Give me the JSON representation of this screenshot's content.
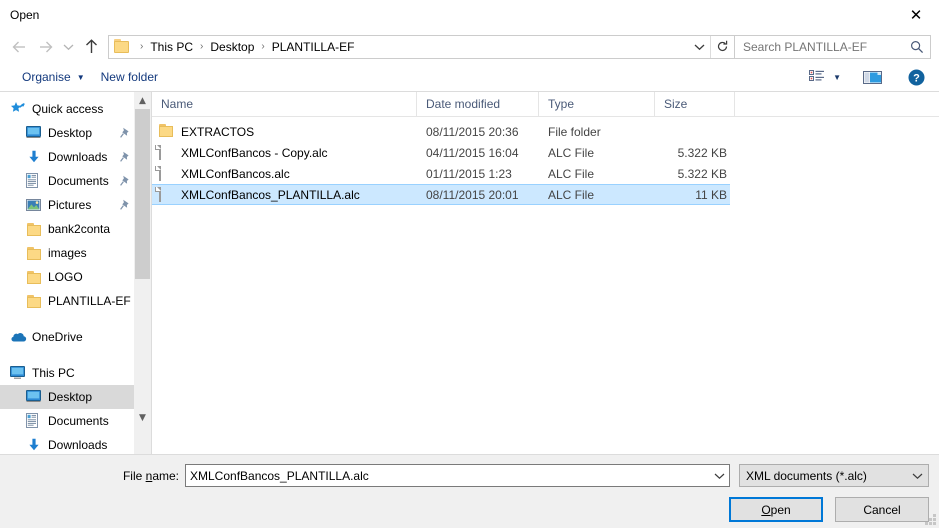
{
  "window": {
    "title": "Open",
    "close_icon": "close-icon"
  },
  "nav": {
    "back_icon": "arrow-left-icon",
    "forward_icon": "arrow-right-icon",
    "recent_icon": "chevron-down-icon",
    "up_icon": "arrow-up-icon",
    "breadcrumb": [
      "This PC",
      "Desktop",
      "PLANTILLA-EF"
    ],
    "breadcrumb_separator": "›",
    "dropdown_icon": "chevron-down-icon",
    "refresh_icon": "refresh-icon",
    "search_placeholder": "Search PLANTILLA-EF",
    "search_value": "",
    "search_icon": "search-icon"
  },
  "commandbar": {
    "organise_label": "Organise",
    "organise_caret": "▼",
    "new_folder_label": "New folder",
    "view_icon": "list-view-icon",
    "view_caret": "▼",
    "preview_pane_icon": "preview-pane-icon",
    "help_icon": "help-icon",
    "help_glyph": "?"
  },
  "sidebar": {
    "scroll_up_icon": "chevron-up-icon",
    "scroll_down_icon": "chevron-down-icon",
    "groups": [
      {
        "header": {
          "label": "Quick access",
          "icon": "star-pin-icon"
        },
        "items": [
          {
            "label": "Desktop",
            "icon": "desktop-icon",
            "pinned": true
          },
          {
            "label": "Downloads",
            "icon": "download-icon",
            "pinned": true
          },
          {
            "label": "Documents",
            "icon": "documents-icon",
            "pinned": true
          },
          {
            "label": "Pictures",
            "icon": "pictures-icon",
            "pinned": true
          },
          {
            "label": "bank2conta",
            "icon": "folder-icon",
            "pinned": false
          },
          {
            "label": "images",
            "icon": "folder-icon",
            "pinned": false
          },
          {
            "label": "LOGO",
            "icon": "folder-icon",
            "pinned": false
          },
          {
            "label": "PLANTILLA-EF",
            "icon": "folder-icon",
            "pinned": false
          }
        ]
      },
      {
        "header": {
          "label": "OneDrive",
          "icon": "onedrive-icon"
        },
        "items": []
      },
      {
        "header": {
          "label": "This PC",
          "icon": "this-pc-icon"
        },
        "items": [
          {
            "label": "Desktop",
            "icon": "desktop-icon",
            "pinned": false,
            "selected": true
          },
          {
            "label": "Documents",
            "icon": "documents-icon",
            "pinned": false
          },
          {
            "label": "Downloads",
            "icon": "download-icon",
            "pinned": false
          }
        ]
      }
    ]
  },
  "filelist": {
    "columns": [
      {
        "label": "Name",
        "sorted": "asc"
      },
      {
        "label": "Date modified"
      },
      {
        "label": "Type"
      },
      {
        "label": "Size"
      }
    ],
    "sort_caret": "˄",
    "rows": [
      {
        "name": "EXTRACTOS",
        "date": "08/11/2015 20:36",
        "type": "File folder",
        "size": "",
        "icon": "folder-icon",
        "selected": false
      },
      {
        "name": "XMLConfBancos - Copy.alc",
        "date": "04/11/2015 16:04",
        "type": "ALC File",
        "size": "5.322 KB",
        "icon": "document-icon",
        "selected": false
      },
      {
        "name": "XMLConfBancos.alc",
        "date": "01/11/2015 1:23",
        "type": "ALC File",
        "size": "5.322 KB",
        "icon": "document-icon",
        "selected": false
      },
      {
        "name": "XMLConfBancos_PLANTILLA.alc",
        "date": "08/11/2015 20:01",
        "type": "ALC File",
        "size": "11 KB",
        "icon": "document-icon",
        "selected": true
      }
    ]
  },
  "footer": {
    "filename_label_pre": "File ",
    "filename_label_accel": "n",
    "filename_label_post": "ame:",
    "filename_label_full": "File name:",
    "filename_value": "XMLConfBancos_PLANTILLA.alc",
    "filename_chevron_icon": "chevron-down-icon",
    "filter_value": "XML documents (*.alc)",
    "filter_chevron_icon": "chevron-down-icon",
    "open_accel": "O",
    "open_rest": "pen",
    "open_label": "Open",
    "cancel_label": "Cancel"
  },
  "colors": {
    "accent": "#0078d7",
    "selection_fill": "#cce8ff",
    "selection_border": "#99d1ff",
    "sidebar_selection": "#d9d9d9",
    "header_text": "#4a5a78",
    "command_text": "#13397d",
    "folder_yellow": "#fcd985",
    "dialog_bg": "#f0f0f0"
  }
}
